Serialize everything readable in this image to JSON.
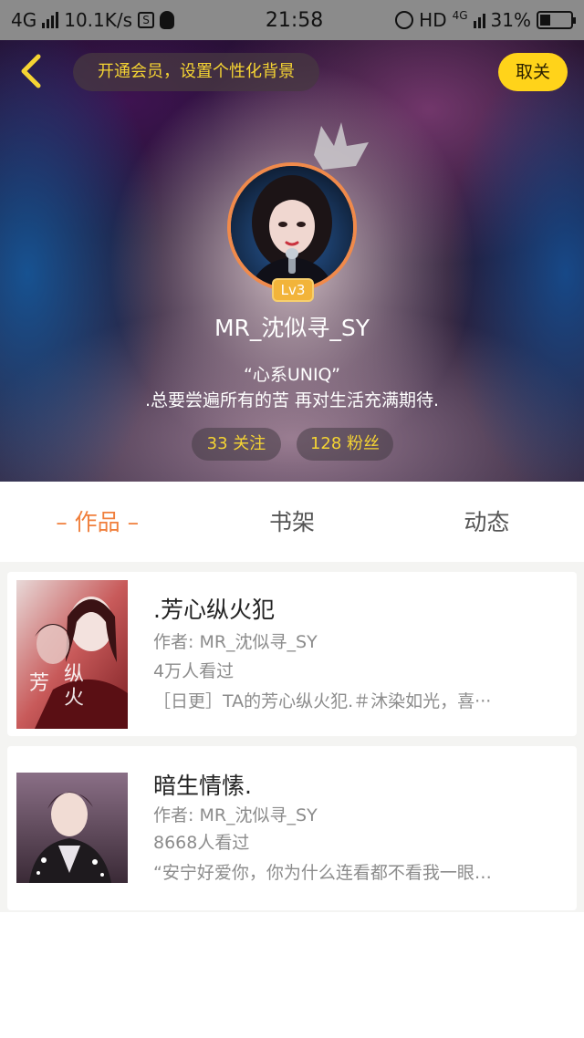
{
  "status_bar": {
    "network": "4G",
    "speed": "10.1K/s",
    "time": "21:58",
    "hd": "HD",
    "net_small": "4G",
    "battery": "31%"
  },
  "header": {
    "member_prompt": "开通会员，设置个性化背景",
    "unfollow_label": "取关"
  },
  "profile": {
    "level": "Lv3",
    "username": "MR_沈似寻_SY",
    "signature_line1": "“心系UNIQ”",
    "signature_line2": ".总要尝遍所有的苦 再对生活充满期待.",
    "following": "33 关注",
    "fans": "128 粉丝"
  },
  "tabs": [
    {
      "label": "– 作品 –",
      "active": true
    },
    {
      "label": "书架",
      "active": false
    },
    {
      "label": "动态",
      "active": false
    }
  ],
  "works": [
    {
      "title": ".芳心纵火犯",
      "author": "作者: MR_沈似寻_SY",
      "views": "4万人看过",
      "desc": "［日更］TA的芳心纵火犯.＃沐染如光，喜···"
    },
    {
      "title": "暗生情愫.",
      "author": "作者: MR_沈似寻_SY",
      "views": "8668人看过",
      "desc": "“安宁好爱你，你为什么连看都不看我一眼…"
    }
  ],
  "colors": {
    "accent_orange": "#f07f3c",
    "gold": "#f5d433",
    "unfollow_bg": "#ffd31a"
  }
}
